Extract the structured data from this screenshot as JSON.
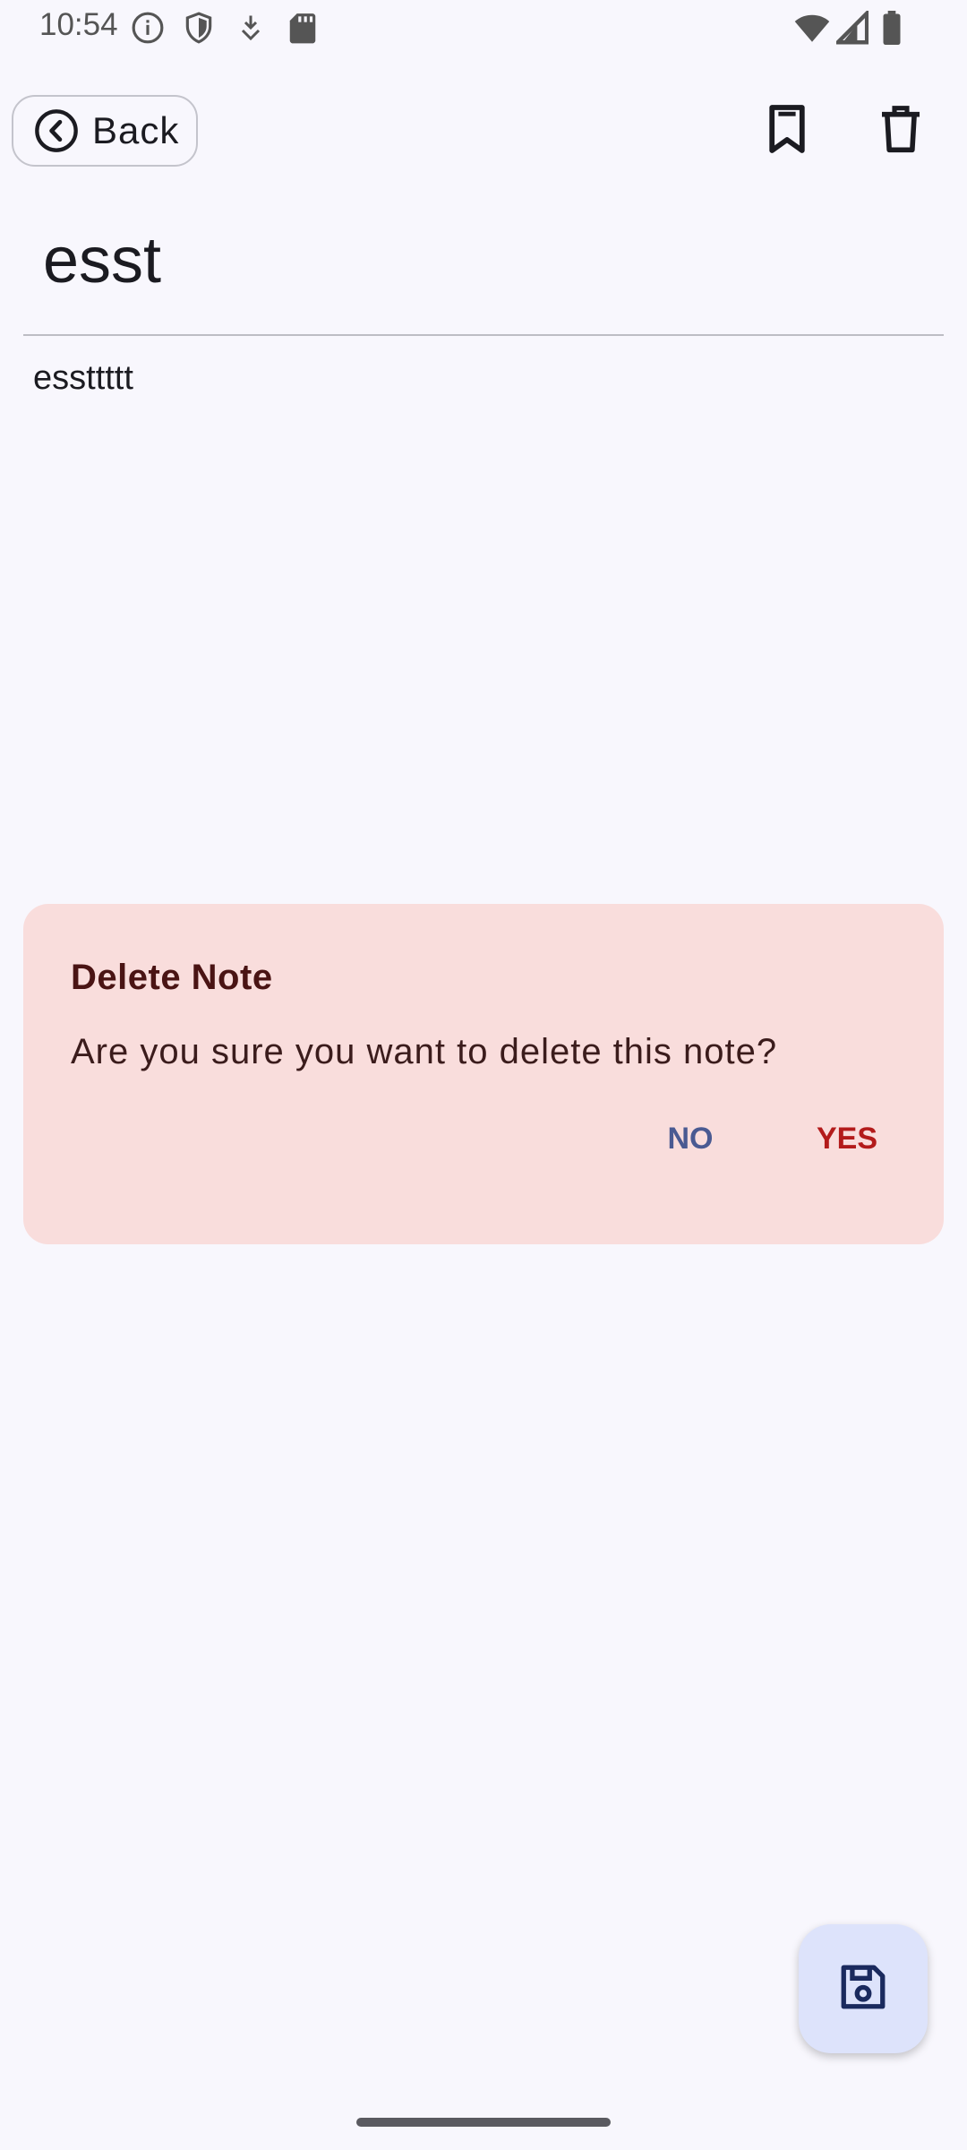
{
  "status_bar": {
    "time": "10:54",
    "left_icons": [
      "info-icon",
      "shield-icon",
      "download-icon",
      "sd-card-icon"
    ],
    "right_icons": [
      "wifi-icon",
      "signal-icon",
      "battery-icon"
    ]
  },
  "top_bar": {
    "back_label": "Back",
    "actions": [
      "bookmark-icon",
      "trash-icon"
    ]
  },
  "note": {
    "title": "esst",
    "body": "essttttt"
  },
  "dialog": {
    "title": "Delete Note",
    "message": "Are you sure you want to delete this note?",
    "no_label": "NO",
    "yes_label": "YES"
  },
  "fab": {
    "icon": "save-icon"
  },
  "colors": {
    "background": "#f8f7fd",
    "dialog_background": "#f9dddc",
    "no_button": "#4a5a92",
    "yes_button": "#b31b1b",
    "fab_background": "#dde3fb"
  }
}
